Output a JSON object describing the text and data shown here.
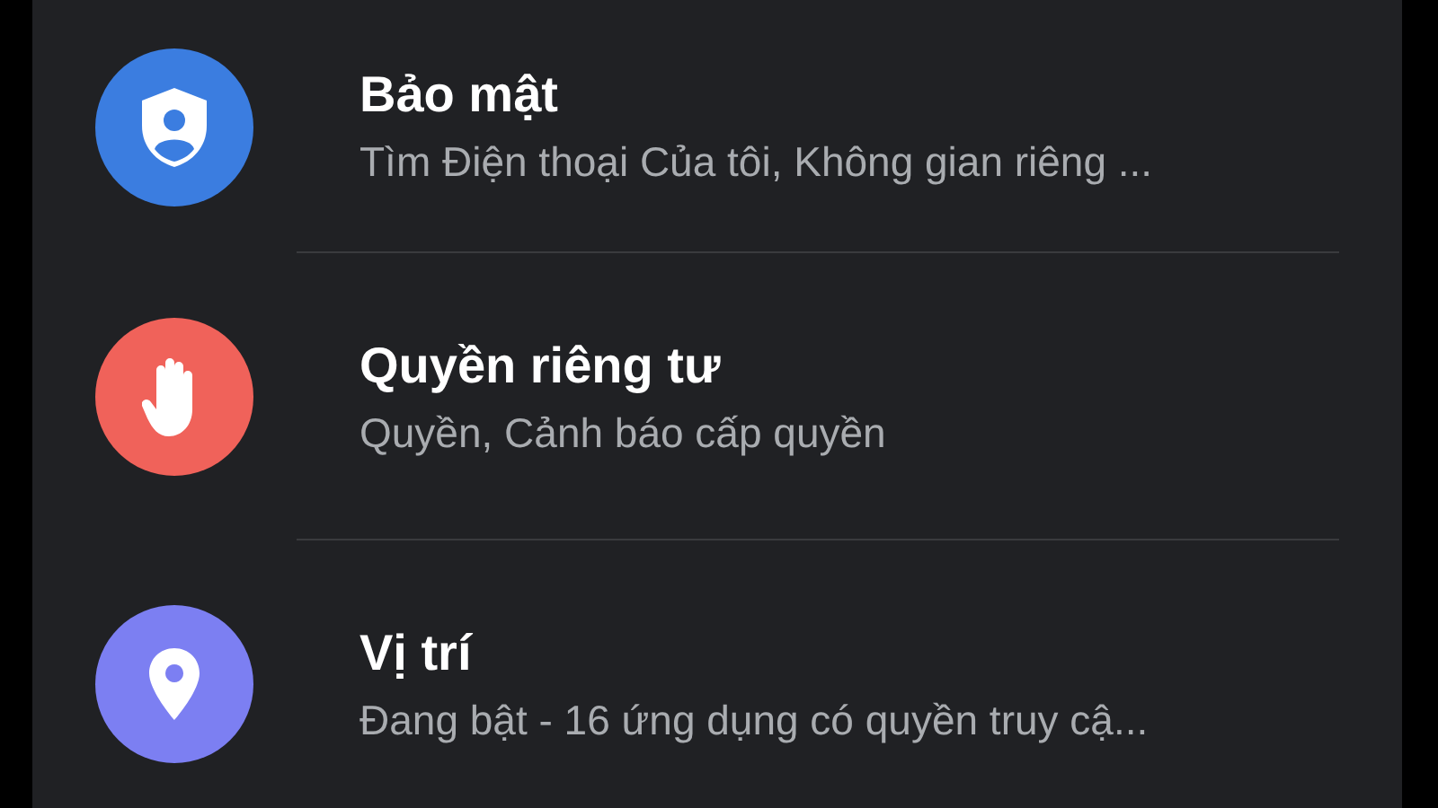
{
  "settings_list": [
    {
      "title": "Bảo mật",
      "subtitle": "Tìm Điện thoại Của tôi, Không gian riêng ...",
      "color": "#3b7de0"
    },
    {
      "title": "Quyền riêng tư",
      "subtitle": "Quyền, Cảnh báo cấp quyền",
      "color": "#f0625a"
    },
    {
      "title": "Vị trí",
      "subtitle": "Đang bật - 16 ứng dụng có quyền truy cậ...",
      "color": "#7c7ff2"
    }
  ]
}
